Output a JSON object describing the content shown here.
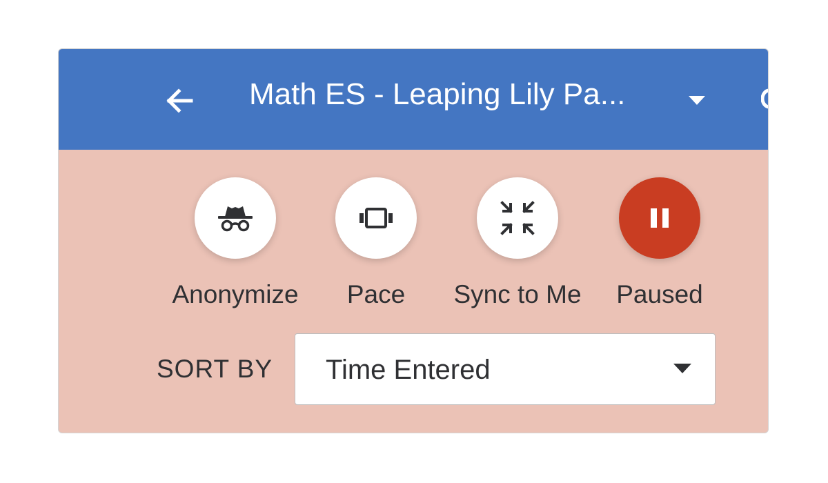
{
  "header": {
    "title": "Math ES - Leaping Lily Pa...",
    "back_icon": "arrow-left-icon",
    "dropdown_icon": "caret-down-icon",
    "background_color": "#4476c2"
  },
  "controls": [
    {
      "id": "anonymize",
      "label": "Anonymize",
      "icon": "incognito-icon"
    },
    {
      "id": "pace",
      "label": "Pace",
      "icon": "view-carousel-icon"
    },
    {
      "id": "sync",
      "label": "Sync to Me",
      "icon": "collapse-arrows-icon"
    },
    {
      "id": "paused",
      "label": "Paused",
      "icon": "pause-icon",
      "active_color": "#c93d22"
    }
  ],
  "sort": {
    "label": "SORT BY",
    "selected": "Time Entered",
    "caret_icon": "caret-down-icon"
  },
  "theme": {
    "panel_color": "#ebc2b6"
  }
}
